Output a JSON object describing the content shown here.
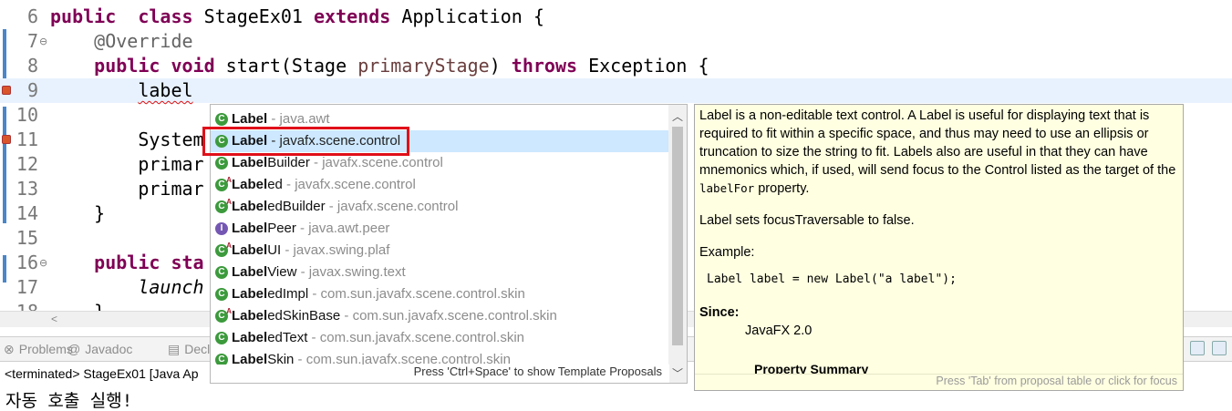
{
  "editor": {
    "lines": [
      {
        "num": "6",
        "parts": [
          [
            "kw",
            "public"
          ],
          [
            "",
            "  "
          ],
          [
            "kw",
            "class"
          ],
          [
            "",
            " StageEx01 "
          ],
          [
            "kw",
            "extends"
          ],
          [
            "",
            " Application {"
          ]
        ]
      },
      {
        "num": "7",
        "fold": "⊖",
        "parts": [
          [
            "",
            "    "
          ],
          [
            "ann",
            "@Override"
          ]
        ]
      },
      {
        "num": "8",
        "parts": [
          [
            "",
            "    "
          ],
          [
            "kw",
            "public"
          ],
          [
            "",
            " "
          ],
          [
            "kw",
            "void"
          ],
          [
            "",
            " start(Stage "
          ],
          [
            "pname",
            "primaryStage"
          ],
          [
            "",
            ") "
          ],
          [
            "kw",
            "throws"
          ],
          [
            "",
            " Exception {"
          ]
        ]
      },
      {
        "num": "9",
        "current": true,
        "marker": true,
        "parts": [
          [
            "",
            "        "
          ],
          [
            "squig",
            "label"
          ]
        ]
      },
      {
        "num": "10",
        "parts": [
          [
            "",
            ""
          ]
        ]
      },
      {
        "num": "11",
        "marker": true,
        "parts": [
          [
            "",
            "        System"
          ]
        ]
      },
      {
        "num": "12",
        "parts": [
          [
            "",
            "        primar"
          ]
        ]
      },
      {
        "num": "13",
        "parts": [
          [
            "",
            "        primar"
          ]
        ]
      },
      {
        "num": "14",
        "parts": [
          [
            "",
            "    }"
          ]
        ]
      },
      {
        "num": "15",
        "parts": [
          [
            "",
            ""
          ]
        ]
      },
      {
        "num": "16",
        "fold": "⊖",
        "parts": [
          [
            "",
            "    "
          ],
          [
            "kw",
            "public"
          ],
          [
            "",
            " "
          ],
          [
            "kw",
            "sta"
          ]
        ]
      },
      {
        "num": "17",
        "parts": [
          [
            "",
            "        "
          ],
          [
            "it",
            "launch"
          ]
        ]
      },
      {
        "num": "18",
        "parts": [
          [
            "",
            "    }"
          ]
        ]
      }
    ]
  },
  "views": {
    "tabs": [
      {
        "label": "Problems",
        "icon": "problems-icon",
        "glyph": "⊗"
      },
      {
        "label": "Javadoc",
        "icon": "javadoc-icon",
        "glyph": "@"
      },
      {
        "label": "Decl",
        "icon": "declaration-icon",
        "glyph": "▤"
      }
    ],
    "console_header": "<terminated> StageEx01 [Java Ap",
    "console_output": "자동 호출 실행!"
  },
  "proposals": {
    "items": [
      {
        "bold": "Label",
        "rest": "",
        "pkg": " - java.awt",
        "icon": "class-icon",
        "kind": "class",
        "pkg_dark": false
      },
      {
        "bold": "Label",
        "rest": "",
        "pkg": " - javafx.scene.control",
        "icon": "class-icon",
        "kind": "class",
        "selected": true,
        "pkg_dark": true
      },
      {
        "bold": "Label",
        "rest": "Builder",
        "pkg": " - javafx.scene.control",
        "icon": "class-icon",
        "kind": "class",
        "pkg_dark": false
      },
      {
        "bold": "Label",
        "rest": "ed",
        "pkg": " - javafx.scene.control",
        "icon": "abstract-class-icon",
        "kind": "abstract",
        "pkg_dark": false
      },
      {
        "bold": "Label",
        "rest": "edBuilder",
        "pkg": " - javafx.scene.control",
        "icon": "abstract-class-icon",
        "kind": "abstract",
        "pkg_dark": false
      },
      {
        "bold": "Label",
        "rest": "Peer",
        "pkg": " - java.awt.peer",
        "icon": "interface-icon",
        "kind": "interface",
        "pkg_dark": false
      },
      {
        "bold": "Label",
        "rest": "UI",
        "pkg": " - javax.swing.plaf",
        "icon": "abstract-class-icon",
        "kind": "abstract",
        "pkg_dark": false
      },
      {
        "bold": "Label",
        "rest": "View",
        "pkg": " - javax.swing.text",
        "icon": "class-icon",
        "kind": "class",
        "pkg_dark": false
      },
      {
        "bold": "Label",
        "rest": "edImpl",
        "pkg": " - com.sun.javafx.scene.control.skin",
        "icon": "class-icon",
        "kind": "class",
        "pkg_dark": false
      },
      {
        "bold": "Label",
        "rest": "edSkinBase",
        "pkg": " - com.sun.javafx.scene.control.skin",
        "icon": "abstract-class-icon",
        "kind": "abstract",
        "pkg_dark": false
      },
      {
        "bold": "Label",
        "rest": "edText",
        "pkg": " - com.sun.javafx.scene.control.skin",
        "icon": "class-icon",
        "kind": "class",
        "pkg_dark": false
      },
      {
        "bold": "Label",
        "rest": "Skin",
        "pkg": " - com.sun.javafx.scene.control.skin",
        "icon": "class-icon",
        "kind": "class",
        "pkg_dark": false
      }
    ],
    "footer": "Press 'Ctrl+Space' to show Template Proposals"
  },
  "javadoc": {
    "p1_a": "Label is a non-editable text control. A Label is useful for displaying text that is required to fit within a specific space, and thus may need to use an ellipsis or truncation to size the string to fit. Labels also are useful in that they can have mnemonics which, if used, will send focus to the Control listed as the target of the ",
    "p1_code": "labelFor",
    "p1_b": " property.",
    "p2": "Label sets focusTraversable to false.",
    "p3": "Example:",
    "code": "Label label = new Label(\"a label\");",
    "since_label": "Since:",
    "since_value": "JavaFX 2.0",
    "property_summary": "Property Summary",
    "footer": "Press 'Tab' from proposal table or click for focus"
  },
  "colors": {
    "keyword": "#7f0055",
    "selection": "#cde8ff",
    "highlight_box": "#e0101a",
    "javadoc_bg": "#ffffe1"
  }
}
